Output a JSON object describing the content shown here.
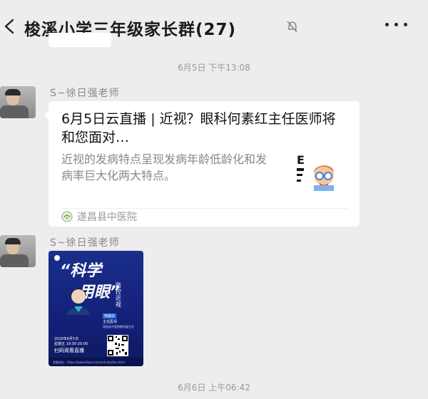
{
  "header": {
    "title": "梭溪小学三年级家长群(27)",
    "back_icon": "chevron-left-icon",
    "mute_icon": "mute-bell-icon",
    "more_icon": "more-dots-icon"
  },
  "messages": {
    "time1": "6月5日 下午13:08",
    "sender1": "S~徐日强老师",
    "card": {
      "title": "6月5日云直播 | 近视？眼科何素红主任医师将和您面对…",
      "desc": "近视的发病特点呈现发病年龄低龄化和发病率巨大化两大特点。",
      "source": "遂昌县中医院",
      "source_icon": "hospital-logo-icon"
    },
    "sender2": "S~徐日强老师",
    "poster": {
      "title_line1": "“科学",
      "title_line2": "用眼”",
      "side_text": "防控近视",
      "tag": "何素红",
      "doc_title": "主任医师",
      "doc_hosp": "遂昌县中医院眼科副主任",
      "date": "2020年6月5日",
      "time": "星期五 19:30-20:00",
      "cta": "扫码观看直播",
      "url": "观看地址：https://www.lillpro.com/activity/8xx.html"
    },
    "time2": "6月6日 上午06:42"
  }
}
